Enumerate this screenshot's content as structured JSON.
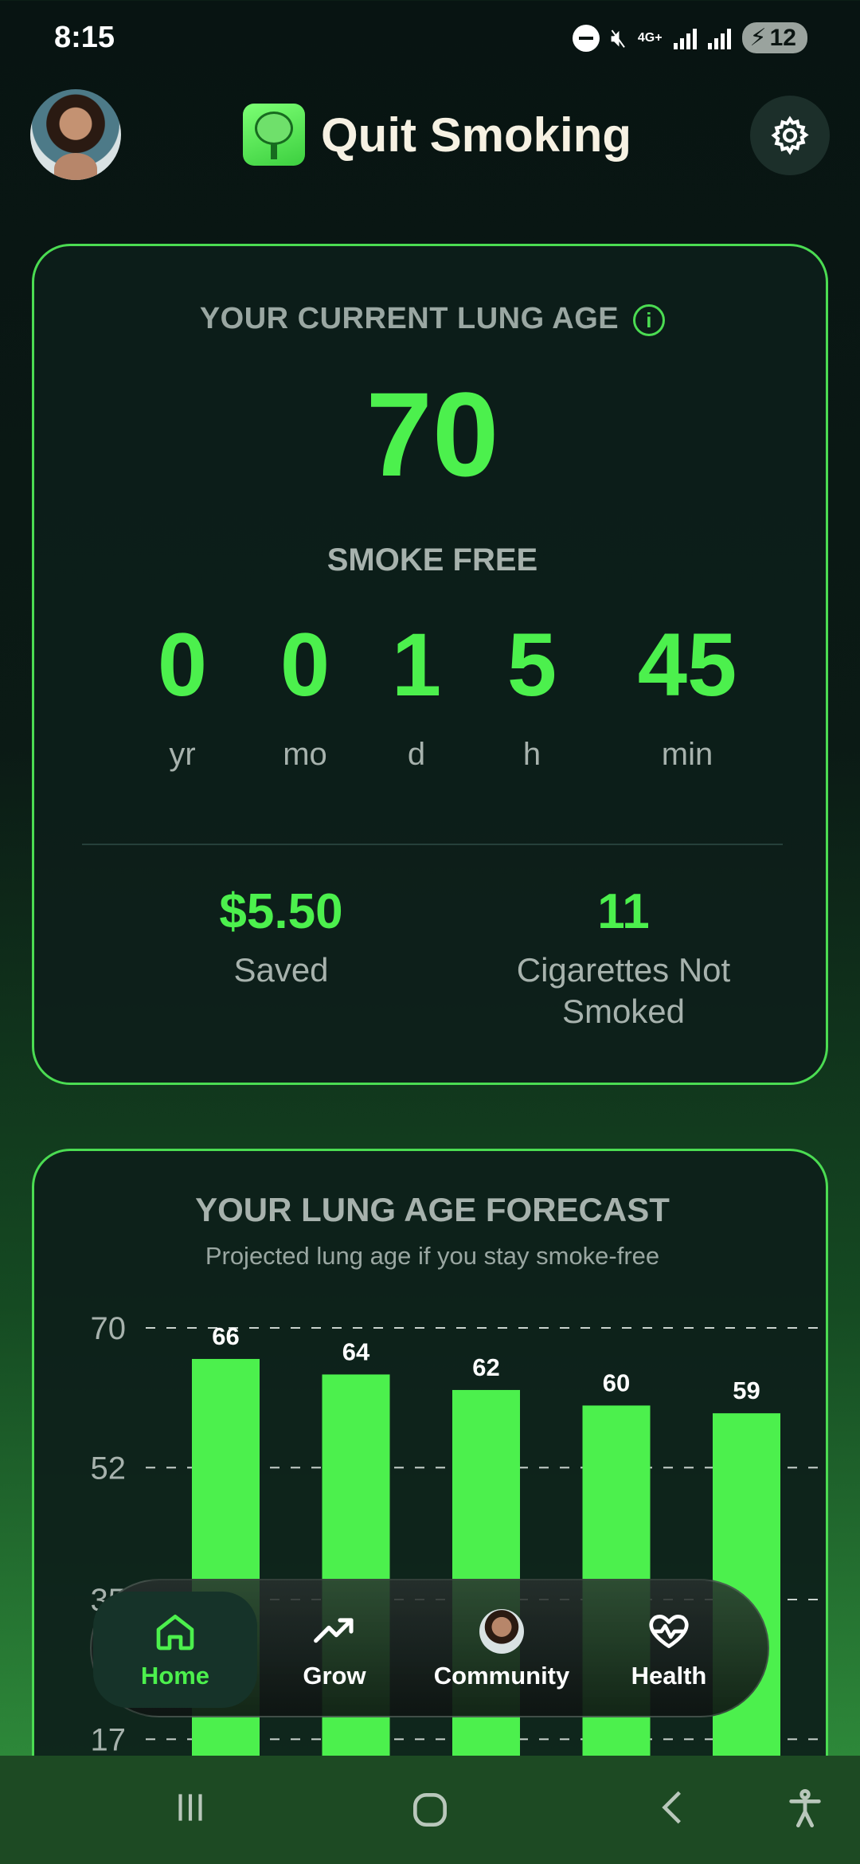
{
  "status_bar": {
    "time": "8:15",
    "network": "4G+",
    "battery": "12"
  },
  "header": {
    "title": "Quit Smoking"
  },
  "lung_card": {
    "label": "YOUR CURRENT LUNG AGE",
    "lung_age": "70",
    "smoke_free_label": "SMOKE FREE",
    "timer": [
      {
        "value": "0",
        "unit": "yr"
      },
      {
        "value": "0",
        "unit": "mo"
      },
      {
        "value": "1",
        "unit": "d"
      },
      {
        "value": "5",
        "unit": "h"
      },
      {
        "value": "45",
        "unit": "min"
      }
    ],
    "saved_value": "$5.50",
    "saved_label": "Saved",
    "cigs_value": "11",
    "cigs_label_line1": "Cigarettes Not",
    "cigs_label_line2": "Smoked"
  },
  "forecast": {
    "title": "YOUR LUNG AGE FORECAST",
    "subtitle": "Projected lung age if you stay smoke-free"
  },
  "chart_data": {
    "type": "bar",
    "title": "YOUR LUNG AGE FORECAST",
    "values": [
      66,
      64,
      62,
      60,
      59
    ],
    "y_ticks": [
      70,
      52,
      35,
      17
    ],
    "ylim": [
      0,
      70
    ],
    "grid": true,
    "bar_color": "#4cf04d"
  },
  "bottom_nav": {
    "items": [
      {
        "label": "Home",
        "icon": "home-icon",
        "active": true
      },
      {
        "label": "Grow",
        "icon": "trending-up-icon",
        "active": false
      },
      {
        "label": "Community",
        "icon": "community-avatar-icon",
        "active": false
      },
      {
        "label": "Health",
        "icon": "heart-pulse-icon",
        "active": false
      }
    ]
  },
  "colors": {
    "accent": "#4cf04d",
    "card_border": "#4bdc52",
    "background": "#081412"
  }
}
